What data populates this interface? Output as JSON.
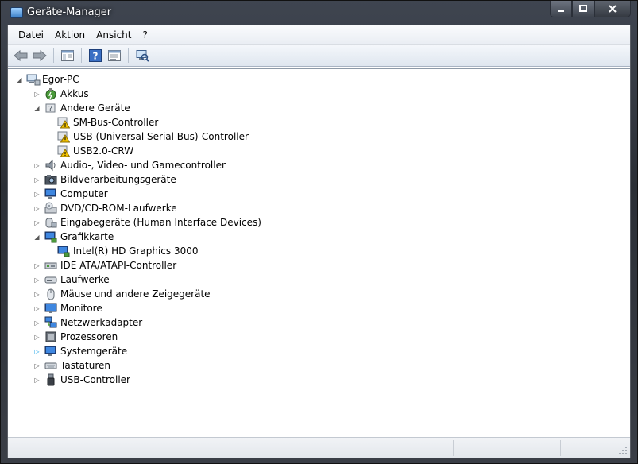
{
  "window": {
    "title": "Geräte-Manager"
  },
  "menu": [
    "Datei",
    "Aktion",
    "Ansicht",
    "?"
  ],
  "toolbar_icons": [
    "back-arrow-icon",
    "forward-arrow-icon",
    "tree-view-icon",
    "help-icon",
    "properties-icon",
    "scan-hardware-icon"
  ],
  "tree": {
    "root": "Egor-PC",
    "items": [
      {
        "label": "Akkus",
        "icon": "battery-icon",
        "expanded": false,
        "children": []
      },
      {
        "label": "Andere Geräte",
        "icon": "unknown-device-icon",
        "expanded": true,
        "children": [
          "SM-Bus-Controller",
          "USB (Universal Serial Bus)-Controller",
          "USB2.0-CRW"
        ]
      },
      {
        "label": "Audio-, Video- und Gamecontroller",
        "icon": "speaker-icon",
        "expanded": false,
        "children": []
      },
      {
        "label": "Bildverarbeitungsgeräte",
        "icon": "camera-icon",
        "expanded": false,
        "children": []
      },
      {
        "label": "Computer",
        "icon": "computer-icon",
        "expanded": false,
        "children": []
      },
      {
        "label": "DVD/CD-ROM-Laufwerke",
        "icon": "optical-drive-icon",
        "expanded": false,
        "children": []
      },
      {
        "label": "Eingabegeräte (Human Interface Devices)",
        "icon": "hid-icon",
        "expanded": false,
        "children": []
      },
      {
        "label": "Grafikkarte",
        "icon": "display-adapter-icon",
        "expanded": true,
        "children": [
          "Intel(R) HD Graphics 3000"
        ]
      },
      {
        "label": "IDE ATA/ATAPI-Controller",
        "icon": "ide-controller-icon",
        "expanded": false,
        "children": []
      },
      {
        "label": "Laufwerke",
        "icon": "disk-drive-icon",
        "expanded": false,
        "children": []
      },
      {
        "label": "Mäuse und andere Zeigegeräte",
        "icon": "mouse-icon",
        "expanded": false,
        "children": []
      },
      {
        "label": "Monitore",
        "icon": "monitor-icon",
        "expanded": false,
        "children": []
      },
      {
        "label": "Netzwerkadapter",
        "icon": "network-adapter-icon",
        "expanded": false,
        "children": []
      },
      {
        "label": "Prozessoren",
        "icon": "processor-icon",
        "expanded": false,
        "children": []
      },
      {
        "label": "Systemgeräte",
        "icon": "system-devices-icon",
        "expanded": false,
        "children": []
      },
      {
        "label": "Tastaturen",
        "icon": "keyboard-icon",
        "expanded": false,
        "children": []
      },
      {
        "label": "USB-Controller",
        "icon": "usb-controller-icon",
        "expanded": false,
        "children": []
      }
    ]
  },
  "colors": {
    "warning": "#f5c400",
    "titlebar": "#3a3f48",
    "tree_bg": "#ffffff"
  }
}
